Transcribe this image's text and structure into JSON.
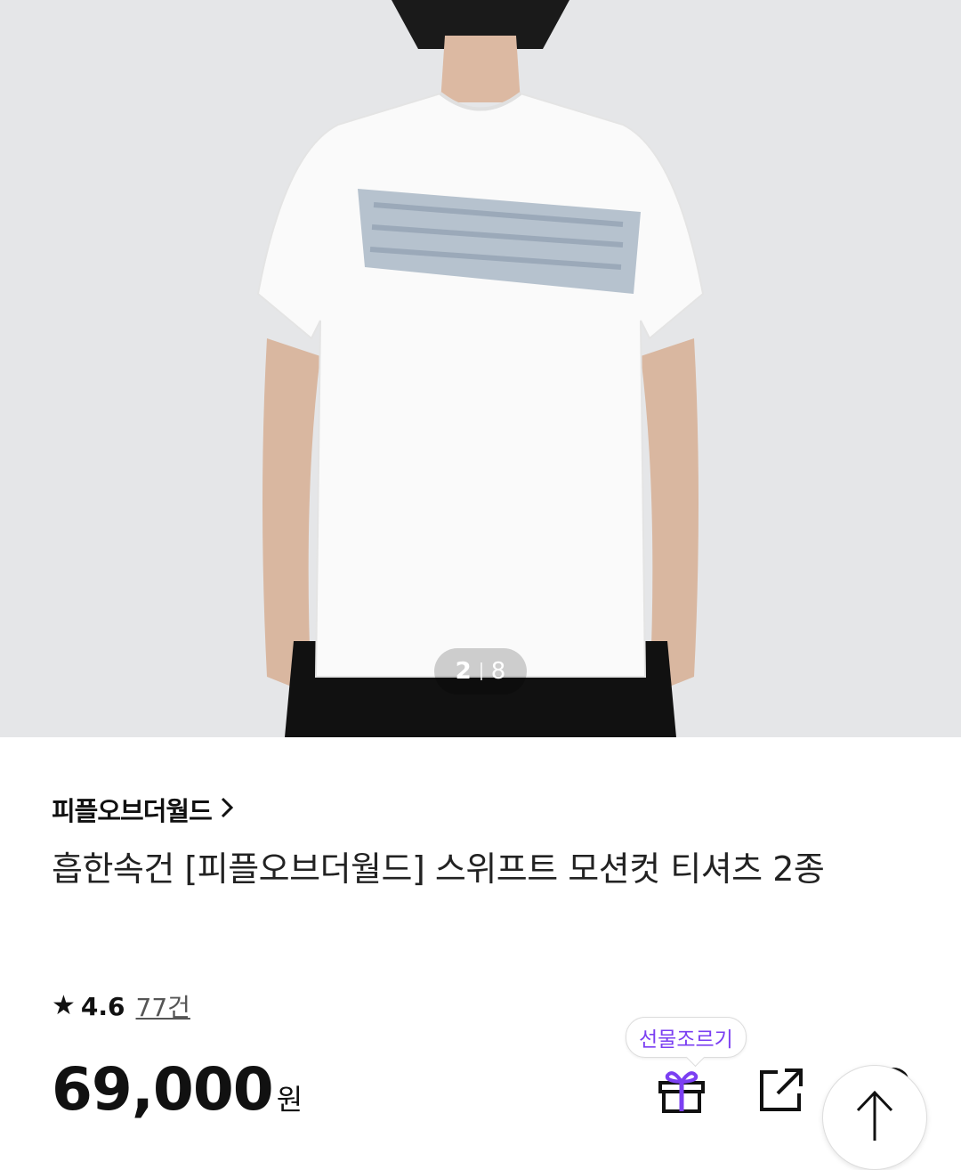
{
  "gallery": {
    "current": "2",
    "total": "8"
  },
  "product": {
    "brand": "피플오브더월드",
    "title": "흡한속건 [피플오브더월드] 스위프트 모션컷 티셔츠 2종",
    "rating": "4.6",
    "review_count": "77건",
    "price": "69,000",
    "currency": "원"
  },
  "actions": {
    "gift_label": "선물조르기"
  },
  "icons": {
    "brand_link": "chevron-right-icon",
    "rating": "star-icon",
    "gift": "gift-icon",
    "share": "share-icon",
    "like": "heart-icon",
    "scroll_top": "arrow-up-icon"
  },
  "colors": {
    "accent": "#7b3ff2",
    "text": "#111111",
    "hero_bg": "#e5e6e8"
  }
}
